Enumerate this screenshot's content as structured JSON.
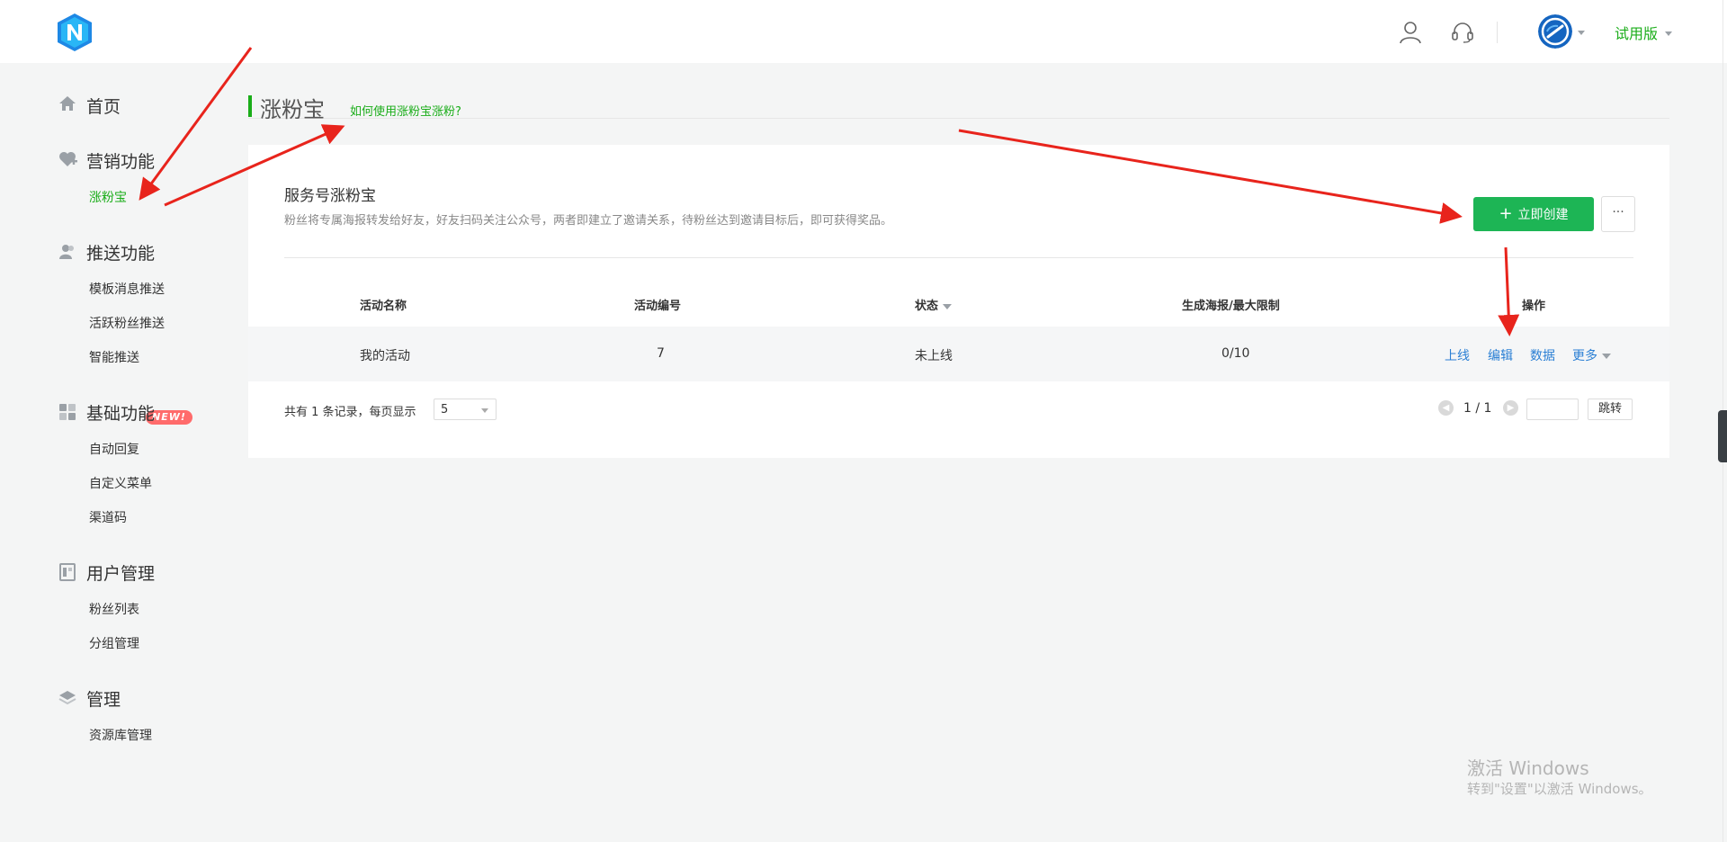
{
  "header": {
    "logo_icon": "n-logo-icon",
    "user_icon": "user-icon",
    "support_icon": "headset-icon",
    "avatar_icon": "account-avatar-icon",
    "trial_label": "试用版"
  },
  "sidebar": {
    "sections": [
      {
        "title": "首页",
        "icon": "home-icon"
      },
      {
        "title": "营销功能",
        "icon": "heart-plus-icon",
        "items": [
          "涨粉宝"
        ]
      },
      {
        "title": "推送功能",
        "icon": "users-icon",
        "items": [
          "模板消息推送",
          "活跃粉丝推送",
          "智能推送"
        ]
      },
      {
        "title": "基础功能",
        "icon": "grid-icon",
        "items": [
          "自动回复",
          "自定义菜单",
          "渠道码"
        ]
      },
      {
        "title": "用户管理",
        "icon": "contacts-book-icon",
        "items": [
          "粉丝列表",
          "分组管理"
        ]
      },
      {
        "title": "管理",
        "icon": "layers-icon",
        "items": [
          "资源库管理"
        ]
      }
    ],
    "active_item": "涨粉宝",
    "new_badge": "NEW!"
  },
  "page": {
    "title": "涨粉宝",
    "help_link": "如何使用涨粉宝涨粉?"
  },
  "panel": {
    "title": "服务号涨粉宝",
    "description": "粉丝将专属海报转发给好友，好友扫码关注公众号，两者即建立了邀请关系，待粉丝达到邀请目标后，即可获得奖品。",
    "create_button": "立即创建",
    "more_button": "···"
  },
  "table": {
    "columns": [
      "活动名称",
      "活动编号",
      "状态",
      "生成海报/最大限制",
      "操作"
    ],
    "rows": [
      {
        "name": "我的活动",
        "id": "7",
        "status": "未上线",
        "posters": "0/10",
        "actions": [
          "上线",
          "编辑",
          "数据",
          "更多"
        ]
      }
    ]
  },
  "pagination": {
    "summary": "共有 1 条记录，每页显示",
    "page_size": "5",
    "page_info": "1 / 1",
    "jump_label": "跳转",
    "jump_value": ""
  },
  "watermark": {
    "line1": "激活 Windows",
    "line2": "转到\"设置\"以激活 Windows。"
  },
  "colors": {
    "accent": "#1aad19",
    "create_button": "#1db555",
    "link": "#2a7fd4",
    "annotation_arrow": "#e8241c"
  }
}
